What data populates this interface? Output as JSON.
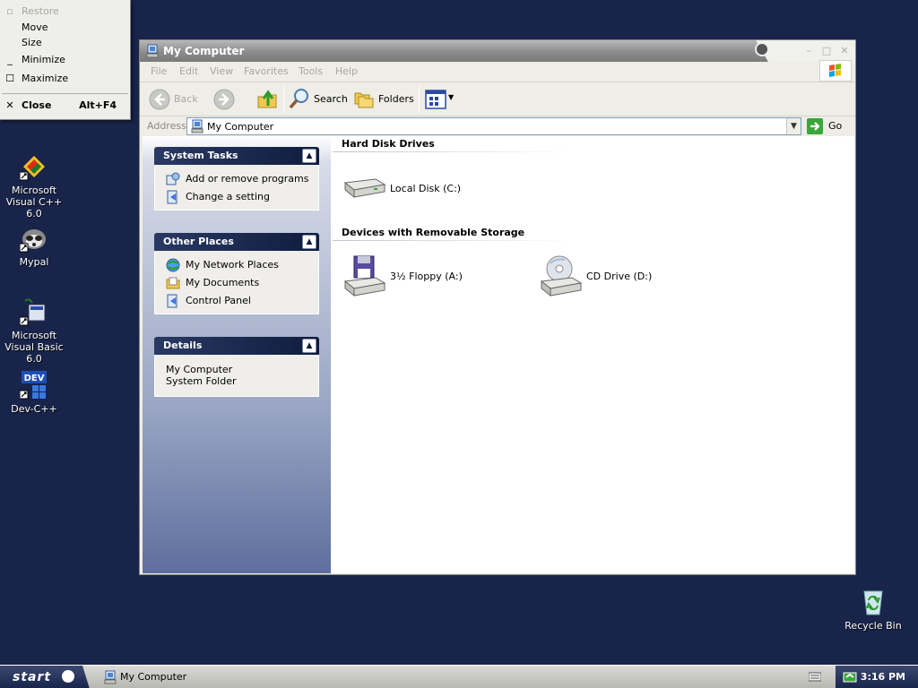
{
  "system_menu": {
    "items": [
      {
        "label": "Restore",
        "mark": "",
        "disabled": true
      },
      {
        "label": "Move",
        "mark": "",
        "disabled": false
      },
      {
        "label": "Size",
        "mark": "",
        "disabled": false
      },
      {
        "label": "Minimize",
        "mark": "_",
        "disabled": false
      },
      {
        "label": "Maximize",
        "mark": "☐",
        "disabled": false
      }
    ],
    "close": {
      "label": "Close",
      "accelerator": "Alt+F4"
    }
  },
  "desktop_icons": [
    {
      "label": "Microsoft Visual C++ 6.0",
      "icon": "visual-cpp-icon"
    },
    {
      "label": "Mypal",
      "icon": "mypal-icon"
    },
    {
      "label": "Microsoft Visual Basic 6.0",
      "icon": "visual-basic-icon"
    },
    {
      "label": "Dev-C++",
      "icon": "dev-cpp-icon"
    }
  ],
  "dev_icon_text": "DEV",
  "recycle_bin": {
    "label": "Recycle Bin"
  },
  "window": {
    "title": "My Computer",
    "menu": [
      "File",
      "Edit",
      "View",
      "Favorites",
      "Tools",
      "Help"
    ],
    "toolbar": {
      "back": "Back",
      "search": "Search",
      "folders": "Folders"
    },
    "address": {
      "label": "Address",
      "value": "My Computer",
      "go": "Go"
    },
    "panels": {
      "system_tasks": {
        "title": "System Tasks",
        "links": [
          "Add or remove programs",
          "Change a setting"
        ]
      },
      "other_places": {
        "title": "Other Places",
        "links": [
          "My Network Places",
          "My Documents",
          "Control Panel"
        ]
      },
      "details": {
        "title": "Details",
        "lines": [
          "My Computer",
          "System Folder"
        ]
      }
    },
    "groups": {
      "hard_disk": {
        "title": "Hard Disk Drives",
        "drives": [
          {
            "label": "Local Disk (C:)",
            "icon": "hard-disk-icon"
          }
        ]
      },
      "removable": {
        "title": "Devices with Removable Storage",
        "drives": [
          {
            "label": "3½ Floppy (A:)",
            "icon": "floppy-drive-icon"
          },
          {
            "label": "CD Drive (D:)",
            "icon": "cd-drive-icon"
          }
        ]
      }
    }
  },
  "taskbar": {
    "start": "start",
    "task_button": "My Computer",
    "clock": "3:16 PM"
  },
  "colors": {
    "desktop": "#18244a",
    "panel_header": "#0f1c3e",
    "title_bar": "#8c8c8c"
  }
}
